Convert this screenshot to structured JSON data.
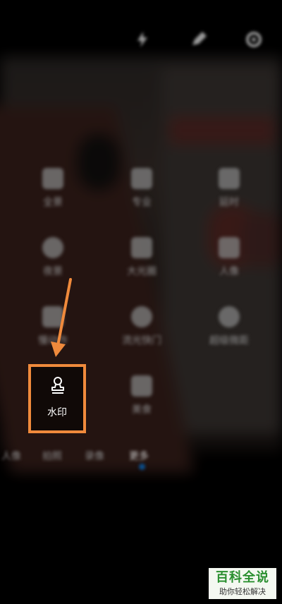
{
  "top_icons": [
    "flash-icon",
    "edit-icon",
    "settings-icon"
  ],
  "modes": [
    {
      "icon": "mode-1-icon",
      "label": "全景"
    },
    {
      "icon": "mode-2-icon",
      "label": "专业"
    },
    {
      "icon": "mode-3-icon",
      "label": "延时"
    },
    {
      "icon": "mode-4-icon",
      "label": "夜景"
    },
    {
      "icon": "mode-5-icon",
      "label": "大光圈"
    },
    {
      "icon": "mode-6-icon",
      "label": "人像"
    },
    {
      "icon": "mode-7-icon",
      "label": "慢动作"
    },
    {
      "icon": "mode-8-icon",
      "label": "流光快门"
    },
    {
      "icon": "mode-9-icon",
      "label": "超级微距"
    },
    {
      "icon": "mode-10-icon",
      "label": "美食"
    }
  ],
  "watermark": {
    "label": "水印",
    "icon": "stamp-icon"
  },
  "mode_strip": [
    "人像",
    "拍照",
    "录像",
    "更多"
  ],
  "accent_color": "#f08a3c",
  "logo": {
    "title": "百科全说",
    "subtitle": "助你轻松解决"
  }
}
